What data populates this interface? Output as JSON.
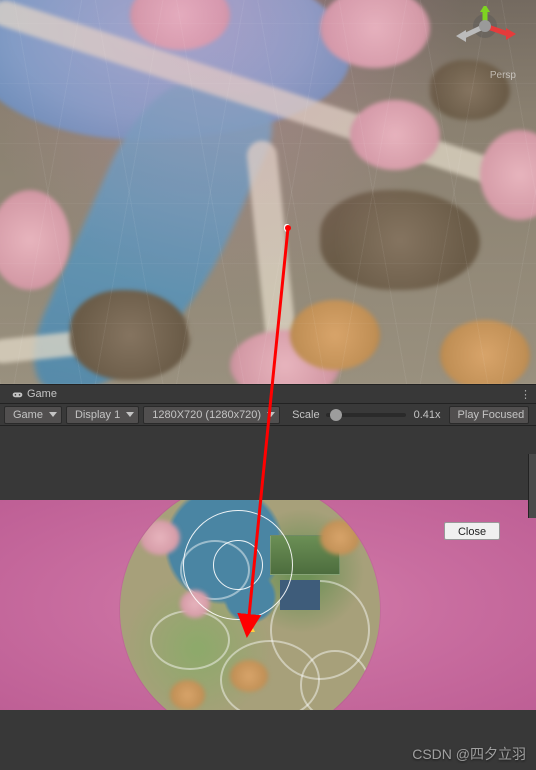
{
  "scene": {
    "gizmo_label": "Persp",
    "gizmo": {
      "x_color": "#e63b3b",
      "y_color": "#7ed321",
      "z_color": "#4a90e2"
    }
  },
  "game_tab": {
    "icon_name": "game-icon",
    "label": "Game"
  },
  "toolbar": {
    "mode_label": "Game",
    "display_label": "Display 1",
    "resolution_label": "1280X720 (1280x720)",
    "scale_label": "Scale",
    "scale_value": "0.41x",
    "play_focused_label": "Play Focused"
  },
  "game_view": {
    "close_label": "Close"
  },
  "watermark": "CSDN @四夕立羽"
}
